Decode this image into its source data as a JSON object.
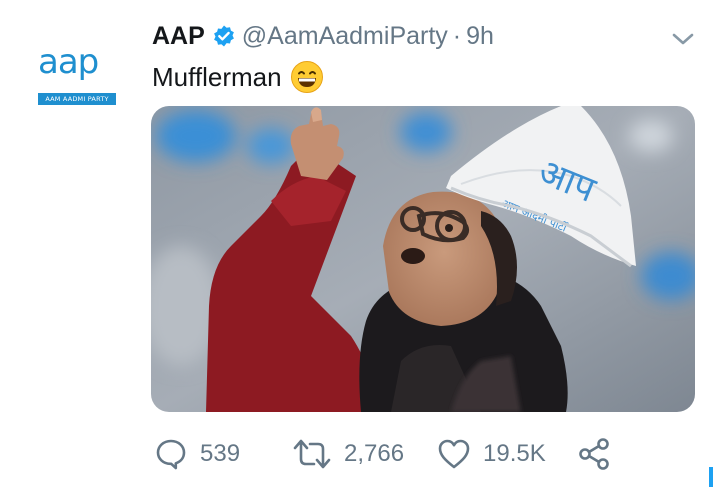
{
  "author": {
    "display_name": "AAP",
    "handle": "@AamAadmiParty",
    "separator": "·",
    "timestamp": "9h",
    "verified": true,
    "avatar_logo_text": "aap",
    "avatar_logo_tagline": "AAM AADMI PARTY"
  },
  "tweet": {
    "text": "Mufflerman",
    "emoji": "grinning-face-emoji"
  },
  "media": {
    "cap_text": "आप",
    "cap_subtext": "आम आदमी पार्टी"
  },
  "actions": {
    "replies": "539",
    "retweets": "2,766",
    "likes": "19.5K"
  },
  "icons": {
    "verified": "verified-badge-icon",
    "more": "chevron-down-icon",
    "reply": "reply-icon",
    "retweet": "retweet-icon",
    "like": "heart-icon",
    "share": "share-icon"
  },
  "colors": {
    "brand": "#1f8fcf",
    "verified": "#1da1f2",
    "muted": "#657786",
    "text": "#14171a"
  }
}
